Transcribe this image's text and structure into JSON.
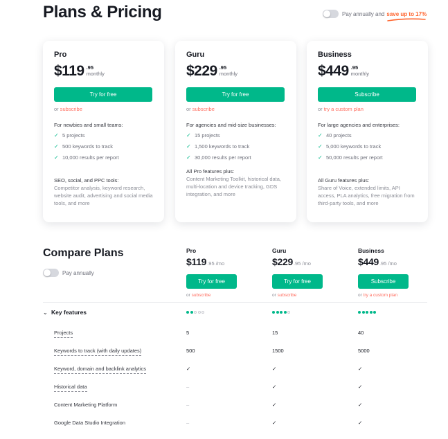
{
  "header": {
    "title": "Plans & Pricing",
    "toggle_label": "Pay annually and",
    "toggle_highlight": "save up to 17%",
    "toggle_on": false
  },
  "colors": {
    "accent": "#00b88a",
    "link": "#ff6a5c",
    "highlight": "#ff642d",
    "text": "#171a22"
  },
  "plans": [
    {
      "name": "Pro",
      "price_dollars": "$119",
      "price_cents": ".95",
      "period": "monthly",
      "cta": "Try for free",
      "or_text": "or",
      "or_link": "subscribe",
      "audience": "For newbies and small teams:",
      "features": [
        "5 projects",
        "500 keywords to track",
        "10,000 results per report"
      ],
      "extras_title": "SEO, social, and PPC tools:",
      "extras_desc": "Competitor analysis, keyword research, website audit, advertising and social media tools, and more"
    },
    {
      "name": "Guru",
      "price_dollars": "$229",
      "price_cents": ".95",
      "period": "monthly",
      "cta": "Try for free",
      "or_text": "or",
      "or_link": "subscribe",
      "audience": "For agencies and mid-size businesses:",
      "features": [
        "15 projects",
        "1,500 keywords to track",
        "30,000 results per report"
      ],
      "extras_title": "All Pro features plus:",
      "extras_desc": "Content Marketing Toolkit, historical data, multi-location and device tracking, GDS integration, and more"
    },
    {
      "name": "Business",
      "price_dollars": "$449",
      "price_cents": ".95",
      "period": "monthly",
      "cta": "Subscribe",
      "or_text": "or",
      "or_link": "try a custom plan",
      "audience": "For large agencies and enterprises:",
      "features": [
        "40 projects",
        "5,000 keywords to track",
        "50,000 results per report"
      ],
      "extras_title": "All Guru features plus:",
      "extras_desc": "Share of Voice, extended limits, API access, PLA analytics, free migration from third-party tools, and more"
    }
  ],
  "compare": {
    "title": "Compare Plans",
    "toggle_label": "Pay annually",
    "toggle_on": false,
    "columns": [
      {
        "name": "Pro",
        "dollars": "$119",
        "rest": ".95 /mo",
        "cta": "Try for free",
        "or_text": "or",
        "or_link": "subscribe",
        "rating": 2
      },
      {
        "name": "Guru",
        "dollars": "$229",
        "rest": ".95 /mo",
        "cta": "Try for free",
        "or_text": "or",
        "or_link": "subscribe",
        "rating": 4
      },
      {
        "name": "Business",
        "dollars": "$449",
        "rest": ".95 /mo",
        "cta": "Subscribe",
        "or_text": "or",
        "or_link": "try a custom plan",
        "rating": 5
      }
    ],
    "rating_max": 5,
    "section": {
      "chevron_icon": "chevron-down-icon",
      "label": "Key features",
      "expanded": true
    },
    "rows": [
      {
        "label": "Projects",
        "dashed": true,
        "values": [
          "5",
          "15",
          "40"
        ]
      },
      {
        "label": "Keywords to track (with daily updates)",
        "dashed": true,
        "values": [
          "500",
          "1500",
          "5000"
        ]
      },
      {
        "label": "Keyword, domain and backlink analytics",
        "dashed": true,
        "values": [
          "check",
          "check",
          "check"
        ]
      },
      {
        "label": "Historical data",
        "dashed": true,
        "values": [
          "dash",
          "check",
          "check"
        ]
      },
      {
        "label": "Content Marketing Platform",
        "dashed": false,
        "values": [
          "dash",
          "check",
          "check"
        ]
      },
      {
        "label": "Google Data Studio Integration",
        "dashed": false,
        "values": [
          "dash",
          "check",
          "check"
        ]
      }
    ]
  }
}
